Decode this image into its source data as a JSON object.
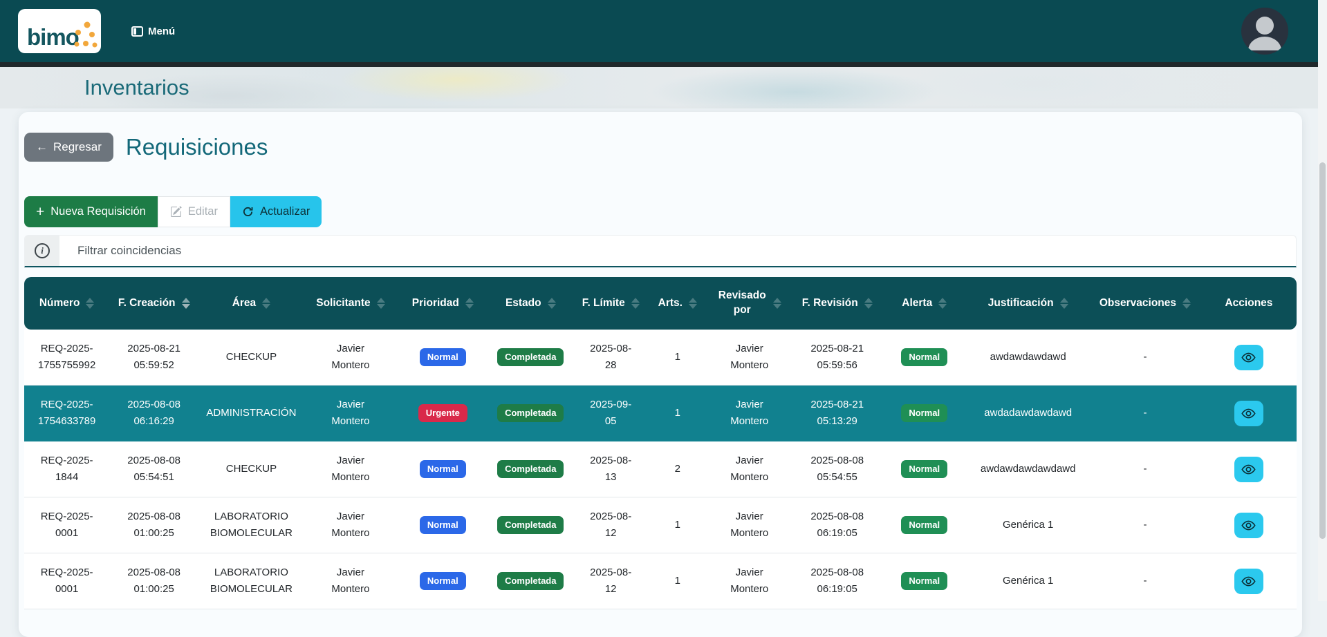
{
  "navbar": {
    "logo_text": "bimo",
    "menu_label": "Menú"
  },
  "banner": {
    "title": "Inventarios"
  },
  "page": {
    "back_label": "Regresar",
    "title": "Requisiciones"
  },
  "toolbar": {
    "new_label": "Nueva Requisición",
    "edit_label": "Editar",
    "refresh_label": "Actualizar"
  },
  "filter": {
    "placeholder": "Filtrar coincidencias"
  },
  "colors": {
    "navbar_teal": "#0a4a52",
    "header_teal": "#0c4f57",
    "selected_row_teal": "#11818f",
    "accent_cyan": "#27c4eb",
    "green_button": "#1d7c46",
    "badge_primary_blue": "#2b68e8",
    "badge_urgent_red": "#d9294a",
    "badge_success_green": "#1e7c47",
    "badge_alert_green": "#1f8f55"
  },
  "table": {
    "columns": [
      {
        "label": "Número",
        "sortable": true
      },
      {
        "label": "F. Creación",
        "sortable": true,
        "sorted": "desc"
      },
      {
        "label": "Área",
        "sortable": true
      },
      {
        "label": "Solicitante",
        "sortable": true
      },
      {
        "label": "Prioridad",
        "sortable": true
      },
      {
        "label": "Estado",
        "sortable": true
      },
      {
        "label": "F. Límite",
        "sortable": true
      },
      {
        "label": "Arts.",
        "sortable": true
      },
      {
        "label": "Revisado por",
        "sortable": true,
        "narrow": true
      },
      {
        "label": "F. Revisión",
        "sortable": true
      },
      {
        "label": "Alerta",
        "sortable": true
      },
      {
        "label": "Justificación",
        "sortable": true
      },
      {
        "label": "Observaciones",
        "sortable": true
      },
      {
        "label": "Acciones",
        "sortable": false
      }
    ],
    "rows": [
      {
        "numero": "REQ-2025-1755755992",
        "f_creacion": "2025-08-21 05:59:52",
        "area": "CHECKUP",
        "solicitante": "Javier Montero",
        "prioridad": "Normal",
        "prioridad_color": "blue",
        "estado": "Completada",
        "f_limite": "2025-08-28",
        "arts": "1",
        "revisado_por": "Javier Montero",
        "f_revision": "2025-08-21 05:59:56",
        "alerta": "Normal",
        "justificacion": "awdawdawdawd",
        "observaciones": "-",
        "selected": false
      },
      {
        "numero": "REQ-2025-1754633789",
        "f_creacion": "2025-08-08 06:16:29",
        "area": "ADMINISTRACIÓN",
        "solicitante": "Javier Montero",
        "prioridad": "Urgente",
        "prioridad_color": "red",
        "estado": "Completada",
        "f_limite": "2025-09-05",
        "arts": "1",
        "revisado_por": "Javier Montero",
        "f_revision": "2025-08-21 05:13:29",
        "alerta": "Normal",
        "justificacion": "awdadawdawdawd",
        "observaciones": "-",
        "selected": true
      },
      {
        "numero": "REQ-2025-1844",
        "f_creacion": "2025-08-08 05:54:51",
        "area": "CHECKUP",
        "solicitante": "Javier Montero",
        "prioridad": "Normal",
        "prioridad_color": "blue",
        "estado": "Completada",
        "f_limite": "2025-08-13",
        "arts": "2",
        "revisado_por": "Javier Montero",
        "f_revision": "2025-08-08 05:54:55",
        "alerta": "Normal",
        "justificacion": "awdawdawdawdawd",
        "observaciones": "-",
        "selected": false
      },
      {
        "numero": "REQ-2025-0001",
        "f_creacion": "2025-08-08 01:00:25",
        "area": "LABORATORIO BIOMOLECULAR",
        "solicitante": "Javier Montero",
        "prioridad": "Normal",
        "prioridad_color": "blue",
        "estado": "Completada",
        "f_limite": "2025-08-12",
        "arts": "1",
        "revisado_por": "Javier Montero",
        "f_revision": "2025-08-08 06:19:05",
        "alerta": "Normal",
        "justificacion": "Genérica 1",
        "observaciones": "-",
        "selected": false
      },
      {
        "numero": "REQ-2025-0001",
        "f_creacion": "2025-08-08 01:00:25",
        "area": "LABORATORIO BIOMOLECULAR",
        "solicitante": "Javier Montero",
        "prioridad": "Normal",
        "prioridad_color": "blue",
        "estado": "Completada",
        "f_limite": "2025-08-12",
        "arts": "1",
        "revisado_por": "Javier Montero",
        "f_revision": "2025-08-08 06:19:05",
        "alerta": "Normal",
        "justificacion": "Genérica 1",
        "observaciones": "-",
        "selected": false
      }
    ]
  }
}
